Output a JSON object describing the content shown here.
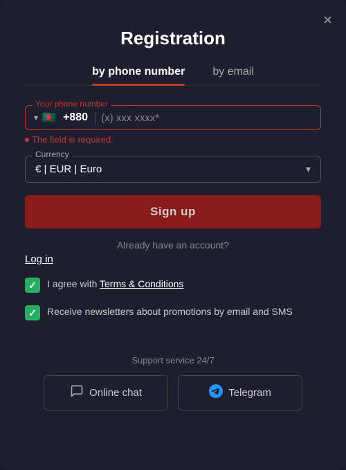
{
  "modal": {
    "title": "Registration",
    "close_label": "×"
  },
  "tabs": [
    {
      "id": "phone",
      "label": "by phone number",
      "active": true
    },
    {
      "id": "email",
      "label": "by email",
      "active": false
    }
  ],
  "phone_field": {
    "label": "Your phone number",
    "flag_emoji": "🇧🇩",
    "country_code": "+880",
    "placeholder": "(x) xxx xxxx*",
    "error": "The field is required."
  },
  "currency_field": {
    "label": "Currency",
    "value": "€ | EUR | Euro"
  },
  "signup_button": {
    "label": "Sign up"
  },
  "account_section": {
    "text": "Already have an account?",
    "login_label": "Log in"
  },
  "checkboxes": [
    {
      "checked": true,
      "label_prefix": "I agree with ",
      "link_text": "Terms & Conditions",
      "label_suffix": ""
    },
    {
      "checked": true,
      "label_prefix": "",
      "link_text": "",
      "label_suffix": "Receive newsletters about promotions by email and SMS"
    }
  ],
  "support": {
    "heading": "Support service 24/7",
    "buttons": [
      {
        "id": "chat",
        "label": "Online chat",
        "icon": "chat-icon"
      },
      {
        "id": "telegram",
        "label": "Telegram",
        "icon": "telegram-icon"
      }
    ]
  }
}
